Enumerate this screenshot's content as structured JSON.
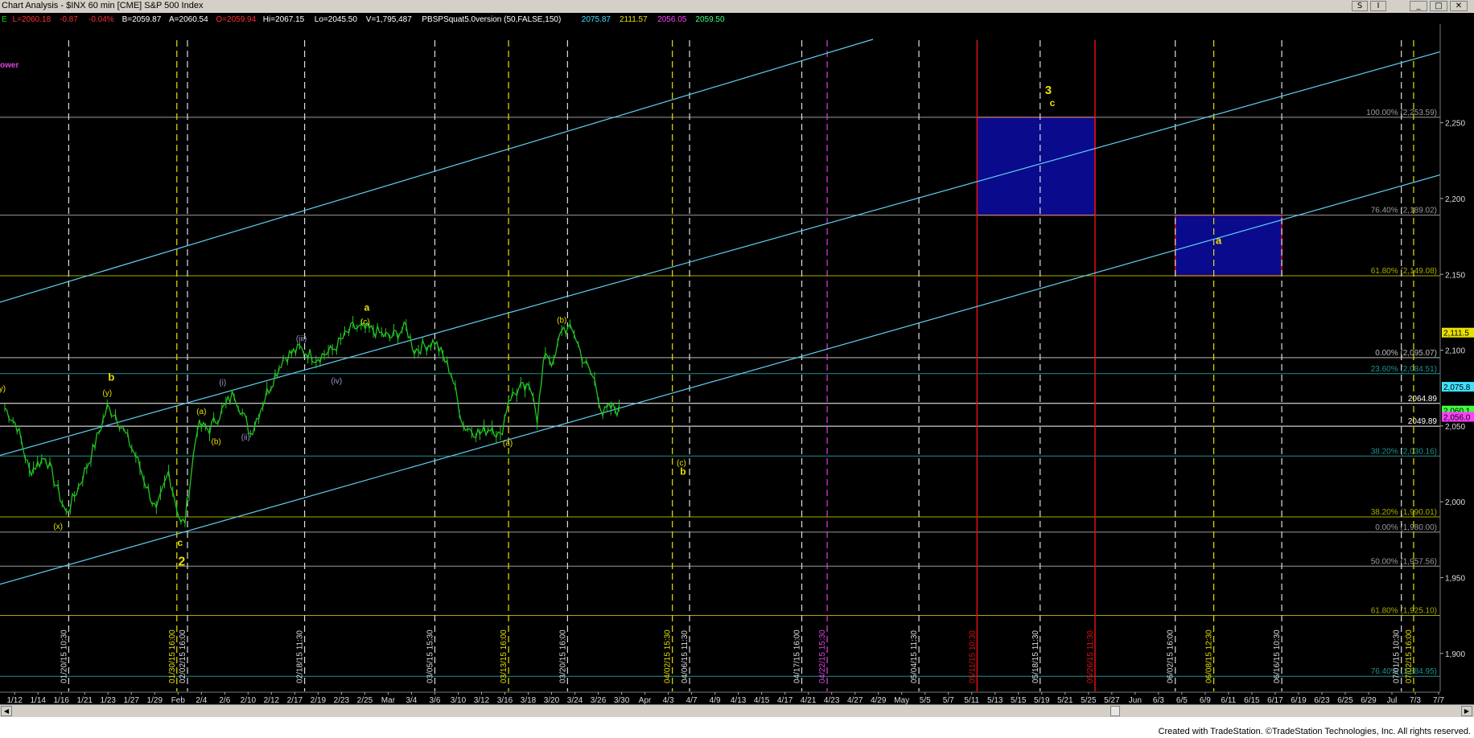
{
  "window": {
    "title": "Chart Analysis - $INX 60 min [CME] S&P 500 Index",
    "buttons": [
      "S",
      "I",
      "_",
      "□",
      "✕"
    ]
  },
  "header_values": [
    {
      "text": "E",
      "color": "#00dd00"
    },
    {
      "text": "L=2060.18",
      "color": "#ff3030"
    },
    {
      "text": "-0.87",
      "color": "#ff3030"
    },
    {
      "text": "-0.04%",
      "color": "#ff3030"
    },
    {
      "text": "B=2059.87",
      "color": "#ffffff"
    },
    {
      "text": "A=2060.54",
      "color": "#ffffff"
    },
    {
      "text": "O=2059.94",
      "color": "#ff3030"
    },
    {
      "text": "Hi=2067.15",
      "color": "#ffffff"
    },
    {
      "text": "Lo=2045.50",
      "color": "#ffffff"
    },
    {
      "text": "V=1,795,487",
      "color": "#ffffff"
    },
    {
      "text": "PBSPSquat5.0version (50,FALSE,150)",
      "color": "#ffffff"
    },
    {
      "text": "2075.87",
      "color": "#40e0ff"
    },
    {
      "text": "2111.57",
      "color": "#e8e000"
    },
    {
      "text": "2056.05",
      "color": "#ff40ff"
    },
    {
      "text": "2059.50",
      "color": "#40ff80"
    }
  ],
  "side_label": "ower",
  "credit": "Created with TradeStation. ©TradeStation Technologies, Inc. All rights reserved.",
  "colors": {
    "background": "#000000",
    "price": "#22c522",
    "channel": "#5fd0f0",
    "wave_label": "#e8e000",
    "box_fill": "#0a0a8c",
    "box_border": "#e01010",
    "red_line": "#e01010",
    "magenta": "#e040e0"
  },
  "chart_data": {
    "type": "line",
    "title": "$INX 60 min [CME] S&P 500 Index",
    "ylim": [
      1875,
      2315
    ],
    "y_ticks": [
      1900,
      1950,
      2000,
      2050,
      2100,
      2150,
      2200,
      2250
    ],
    "y_tick_labels": [
      "1,900",
      "1,950",
      "2,000",
      "2,050",
      "2,100",
      "2,150",
      "2,200",
      "2,250"
    ],
    "x_ticks": [
      "1/12",
      "1/14",
      "1/16",
      "1/21",
      "1/23",
      "1/27",
      "1/29",
      "Feb",
      "2/4",
      "2/6",
      "2/10",
      "2/12",
      "2/17",
      "2/19",
      "2/23",
      "2/25",
      "Mar",
      "3/4",
      "3/6",
      "3/10",
      "3/12",
      "3/16",
      "3/18",
      "3/20",
      "3/24",
      "3/26",
      "3/30",
      "Apr",
      "4/3",
      "4/7",
      "4/9",
      "4/13",
      "4/15",
      "4/17",
      "4/21",
      "4/23",
      "4/27",
      "4/29",
      "May",
      "5/5",
      "5/7",
      "5/11",
      "5/13",
      "5/15",
      "5/19",
      "5/21",
      "5/25",
      "5/27",
      "Jun",
      "6/3",
      "6/5",
      "6/9",
      "6/11",
      "6/15",
      "6/17",
      "6/19",
      "6/23",
      "6/25",
      "6/29",
      "Jul",
      "7/3",
      "7/7"
    ],
    "price_series": {
      "name": "",
      "keypoints": [
        {
          "x": 0.0,
          "y": 2062
        },
        {
          "x": 1.5,
          "y": 2050
        },
        {
          "x": 3.0,
          "y": 2020
        },
        {
          "x": 5.0,
          "y": 2030
        },
        {
          "x": 7.5,
          "y": 1992
        },
        {
          "x": 9.0,
          "y": 2010
        },
        {
          "x": 10.5,
          "y": 2030
        },
        {
          "x": 12.5,
          "y": 2062
        },
        {
          "x": 13.5,
          "y": 2058
        },
        {
          "x": 16.0,
          "y": 2030
        },
        {
          "x": 18.5,
          "y": 1993
        },
        {
          "x": 20.0,
          "y": 2020
        },
        {
          "x": 21.5,
          "y": 1985
        },
        {
          "x": 22.0,
          "y": 1988
        },
        {
          "x": 23.5,
          "y": 2050
        },
        {
          "x": 25.0,
          "y": 2048
        },
        {
          "x": 26.5,
          "y": 2060
        },
        {
          "x": 28.0,
          "y": 2072
        },
        {
          "x": 30.0,
          "y": 2045
        },
        {
          "x": 32.0,
          "y": 2072
        },
        {
          "x": 34.0,
          "y": 2095
        },
        {
          "x": 36.0,
          "y": 2101
        },
        {
          "x": 38.0,
          "y": 2095
        },
        {
          "x": 40.0,
          "y": 2100
        },
        {
          "x": 42.5,
          "y": 2115
        },
        {
          "x": 45.0,
          "y": 2113
        },
        {
          "x": 47.0,
          "y": 2108
        },
        {
          "x": 49.0,
          "y": 2115
        },
        {
          "x": 50.0,
          "y": 2100
        },
        {
          "x": 52.5,
          "y": 2106
        },
        {
          "x": 54.5,
          "y": 2085
        },
        {
          "x": 56.0,
          "y": 2050
        },
        {
          "x": 58.0,
          "y": 2045
        },
        {
          "x": 59.5,
          "y": 2050
        },
        {
          "x": 60.5,
          "y": 2042
        },
        {
          "x": 61.5,
          "y": 2068
        },
        {
          "x": 63.0,
          "y": 2075
        },
        {
          "x": 64.5,
          "y": 2073
        },
        {
          "x": 65.0,
          "y": 2055
        },
        {
          "x": 66.0,
          "y": 2100
        },
        {
          "x": 67.0,
          "y": 2090
        },
        {
          "x": 68.0,
          "y": 2115
        },
        {
          "x": 69.5,
          "y": 2112
        },
        {
          "x": 70.5,
          "y": 2095
        },
        {
          "x": 72.0,
          "y": 2080
        },
        {
          "x": 73.0,
          "y": 2058
        },
        {
          "x": 74.0,
          "y": 2062
        },
        {
          "x": 75.0,
          "y": 2060
        }
      ]
    },
    "channel_lines": [
      {
        "x1": -1,
        "y1": 2131,
        "x2": 106,
        "y2": 2305
      },
      {
        "x1": -1,
        "y1": 2030,
        "x2": 182,
        "y2": 2307
      },
      {
        "x1": -1,
        "y1": 1945,
        "x2": 182,
        "y2": 2226
      }
    ],
    "horizontal_levels": [
      {
        "y": 2253.59,
        "label": "100.00% (2,253.59)",
        "color": "#9a9a9a"
      },
      {
        "y": 2189.02,
        "label": "76.40% (2,189.02)",
        "color": "#9a9a9a"
      },
      {
        "y": 2149.08,
        "label": "61.80% (2,149.08)",
        "color": "#aaaa00"
      },
      {
        "y": 2095.07,
        "label": "0.00% (2,095.07)",
        "color": "#bbbbbb"
      },
      {
        "y": 2084.51,
        "label": "23.60% (2,084.51)",
        "color": "#209090"
      },
      {
        "y": 2064.89,
        "label": "2064.89",
        "color": "#ffffff"
      },
      {
        "y": 2049.89,
        "label": "2049.89",
        "color": "#ffffff"
      },
      {
        "y": 2030.16,
        "label": "38.20% (2,030.16)",
        "color": "#209090"
      },
      {
        "y": 1990.01,
        "label": "38.20% (1,990.01)",
        "color": "#aaaa00"
      },
      {
        "y": 1980.0,
        "label": "0.00% (1,980.00)",
        "color": "#9a9a9a"
      },
      {
        "y": 1957.56,
        "label": "50.00% (1,957.56)",
        "color": "#9a9a9a"
      },
      {
        "y": 1925.1,
        "label": "61.80% (1,925.10)",
        "color": "#aaaa00"
      },
      {
        "y": 1884.95,
        "label": "76.40% (1,884.95)",
        "color": "#209090"
      }
    ],
    "price_tags": [
      {
        "y": 2111.57,
        "label": "2,111.5",
        "bg": "#e8e000",
        "fg": "#000000"
      },
      {
        "y": 2075.87,
        "label": "2,075.8",
        "bg": "#40e0ff",
        "fg": "#000000"
      },
      {
        "y": 2060.18,
        "label": "2,060.1",
        "bg": "#40ff40",
        "fg": "#000000"
      },
      {
        "y": 2056.05,
        "label": "2,056.0",
        "bg": "#ff40ff",
        "fg": "#000000"
      }
    ],
    "vertical_markers": [
      {
        "x": 7.8,
        "label": "01/20/15 10:30",
        "color": "#dddddd",
        "style": "dash"
      },
      {
        "x": 21.0,
        "label": "01/30/15 16:00",
        "color": "#e8e000",
        "style": "dash"
      },
      {
        "x": 22.3,
        "label": "02/02/15 16:00",
        "color": "#dddddd",
        "style": "dash"
      },
      {
        "x": 36.6,
        "label": "02/18/15 11:30",
        "color": "#dddddd",
        "style": "dash"
      },
      {
        "x": 52.5,
        "label": "03/05/15 15:30",
        "color": "#dddddd",
        "style": "dash"
      },
      {
        "x": 61.5,
        "label": "03/13/15 16:00",
        "color": "#e8e000",
        "style": "dash"
      },
      {
        "x": 68.7,
        "label": "03/20/15 16:00",
        "color": "#dddddd",
        "style": "dash"
      },
      {
        "x": 81.5,
        "label": "04/02/15 15:30",
        "color": "#e8e000",
        "style": "dash"
      },
      {
        "x": 83.6,
        "label": "04/06/15 11:30",
        "color": "#dddddd",
        "style": "dash"
      },
      {
        "x": 97.3,
        "label": "04/17/15 16:00",
        "color": "#dddddd",
        "style": "dash"
      },
      {
        "x": 100.4,
        "label": "04/22/15 15:30",
        "color": "#e040e0",
        "style": "dash"
      },
      {
        "x": 111.6,
        "label": "05/04/15 11:30",
        "color": "#dddddd",
        "style": "dash"
      },
      {
        "x": 118.7,
        "label": "05/11/15 10:30",
        "color": "#e01010",
        "style": "solid"
      },
      {
        "x": 126.4,
        "label": "05/18/15 11:30",
        "color": "#dddddd",
        "style": "dash"
      },
      {
        "x": 133.1,
        "label": "05/26/15 11:30",
        "color": "#e01010",
        "style": "solid"
      },
      {
        "x": 142.9,
        "label": "06/02/15 16:00",
        "color": "#dddddd",
        "style": "dash"
      },
      {
        "x": 147.6,
        "label": "06/08/15 12:30",
        "color": "#e8e000",
        "style": "dash"
      },
      {
        "x": 155.9,
        "label": "06/16/15 10:30",
        "color": "#dddddd",
        "style": "dash"
      },
      {
        "x": 170.5,
        "label": "07/01/15 10:30",
        "color": "#dddddd",
        "style": "dash"
      },
      {
        "x": 172.0,
        "label": "07/02/15 16:00",
        "color": "#e8e000",
        "style": "dash"
      }
    ],
    "target_boxes": [
      {
        "x1": 118.7,
        "x2": 133.1,
        "y1": 2189.02,
        "y2": 2253.59
      },
      {
        "x1": 142.9,
        "x2": 155.9,
        "y1": 2149.08,
        "y2": 2189.02
      }
    ],
    "wave_labels": [
      {
        "x": -0.3,
        "y": 2073,
        "text": "y)",
        "size": 10,
        "color": "#e8e000"
      },
      {
        "x": 13.0,
        "y": 2080,
        "text": "b",
        "size": 13,
        "color": "#e8e000",
        "bold": true
      },
      {
        "x": 12.5,
        "y": 2070,
        "text": "(y)",
        "size": 10,
        "color": "#e8e000"
      },
      {
        "x": 6.5,
        "y": 1982,
        "text": "(x)",
        "size": 10,
        "color": "#e8e000"
      },
      {
        "x": 21.4,
        "y": 1971,
        "text": "c",
        "size": 12,
        "color": "#e8e000",
        "bold": true
      },
      {
        "x": 21.6,
        "y": 1958,
        "text": "2",
        "size": 16,
        "color": "#e8e000",
        "bold": true
      },
      {
        "x": 24.0,
        "y": 2058,
        "text": "(a)",
        "size": 10,
        "color": "#e8e000"
      },
      {
        "x": 25.8,
        "y": 2038,
        "text": "(b)",
        "size": 10,
        "color": "#e8e000"
      },
      {
        "x": 26.6,
        "y": 2077,
        "text": "(i)",
        "size": 10,
        "color": "#9a9ad0"
      },
      {
        "x": 29.4,
        "y": 2041,
        "text": "(ii)",
        "size": 10,
        "color": "#9a9ad0"
      },
      {
        "x": 36.2,
        "y": 2106,
        "text": "(iii)",
        "size": 10,
        "color": "#9a9ad0"
      },
      {
        "x": 40.5,
        "y": 2078,
        "text": "(iv)",
        "size": 10,
        "color": "#9a9ad0"
      },
      {
        "x": 44.2,
        "y": 2126,
        "text": "a",
        "size": 12,
        "color": "#e8e000",
        "bold": true
      },
      {
        "x": 44.0,
        "y": 2117,
        "text": "(c)",
        "size": 10,
        "color": "#e8e000"
      },
      {
        "x": 61.4,
        "y": 2037,
        "text": "(a)",
        "size": 10,
        "color": "#e8e000"
      },
      {
        "x": 68.0,
        "y": 2118,
        "text": "(b)",
        "size": 10,
        "color": "#e8e000"
      },
      {
        "x": 82.6,
        "y": 2024,
        "text": "(c)",
        "size": 10,
        "color": "#e8e000"
      },
      {
        "x": 82.8,
        "y": 2018,
        "text": "b",
        "size": 12,
        "color": "#e8e000",
        "bold": true
      },
      {
        "x": 127.4,
        "y": 2269,
        "text": "3",
        "size": 15,
        "color": "#e8e000",
        "bold": true
      },
      {
        "x": 127.9,
        "y": 2261,
        "text": "c",
        "size": 12,
        "color": "#e8e000",
        "bold": true
      },
      {
        "x": 148.2,
        "y": 2170,
        "text": "a",
        "size": 13,
        "color": "#e8e000",
        "bold": true
      }
    ]
  }
}
